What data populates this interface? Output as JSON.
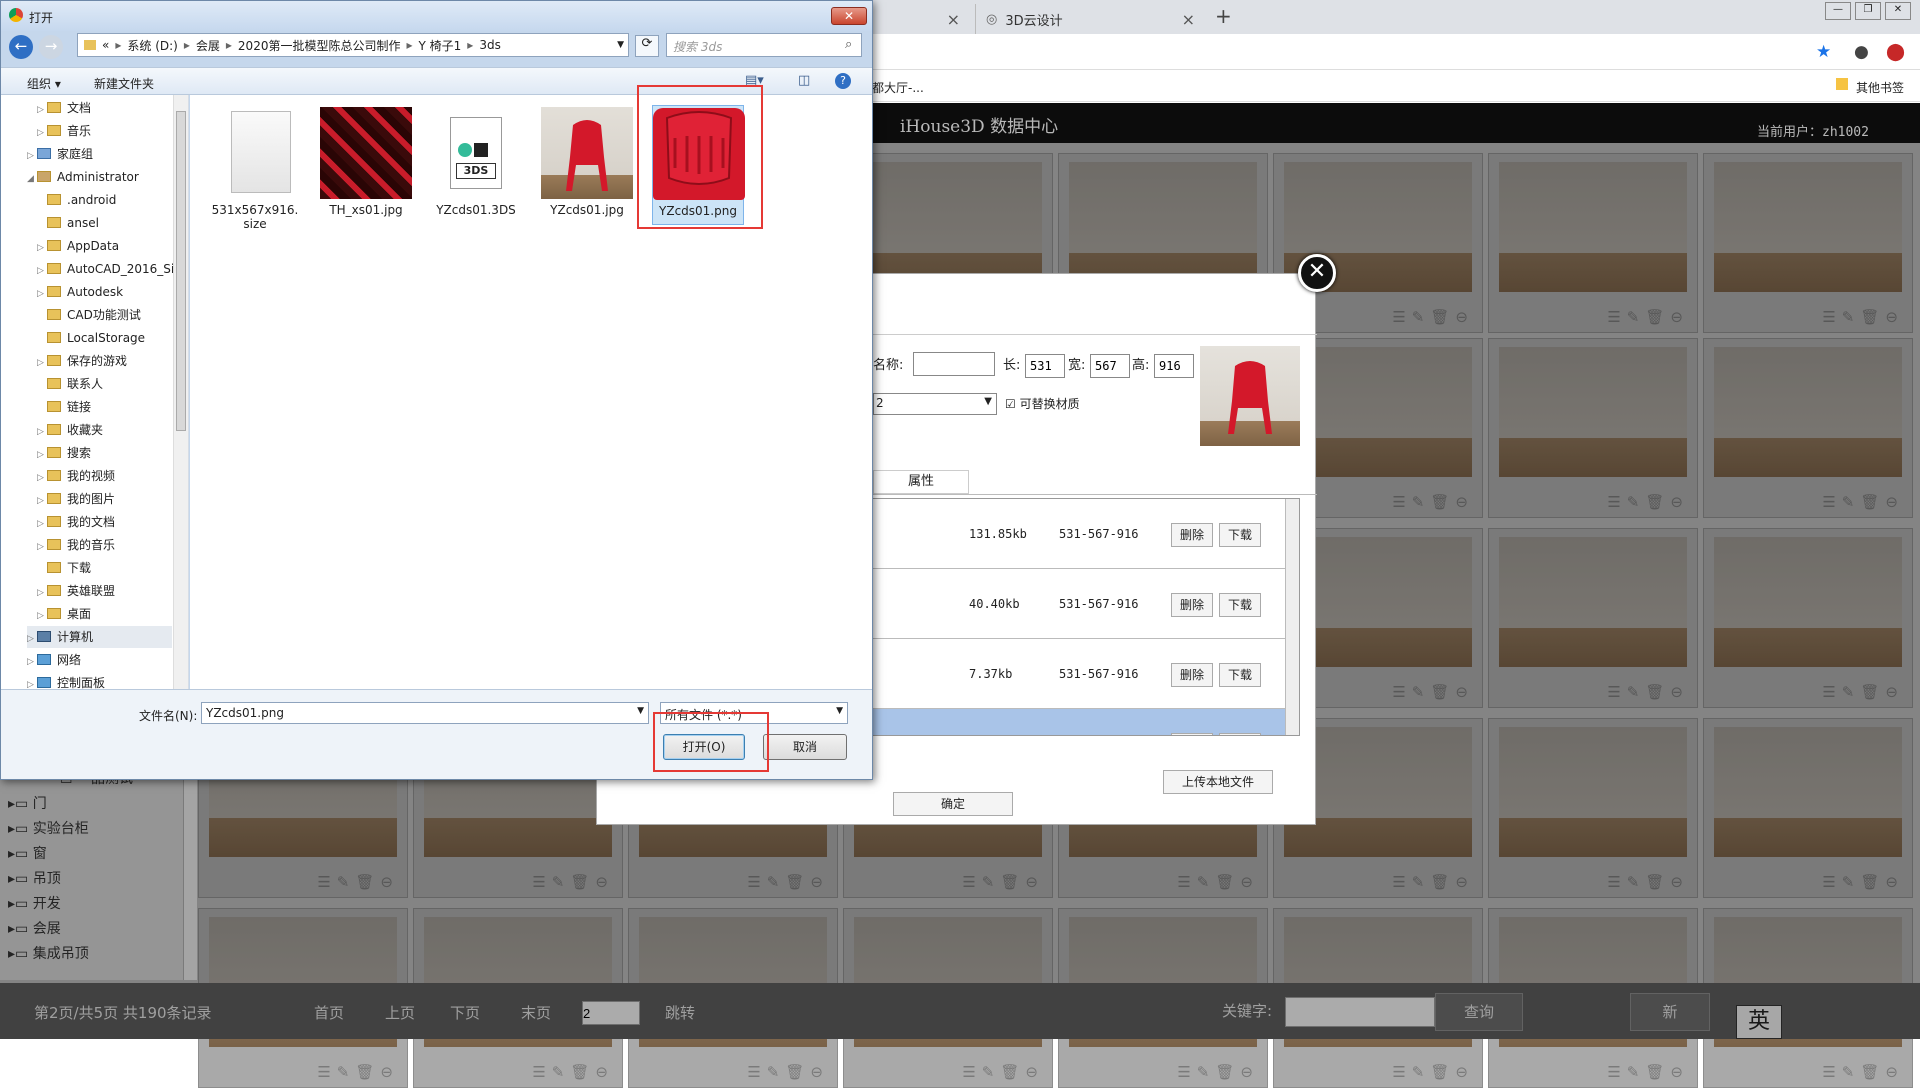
{
  "browser": {
    "tabs": [
      {
        "label": ""
      },
      {
        "label": "3D云设计"
      }
    ],
    "bookmark_partial": "都大厅-...",
    "other_bookmarks": "其他书签"
  },
  "app": {
    "title": "iHouse3D 数据中心",
    "current_user": "当前用户：zh1002"
  },
  "left_nav": {
    "items": [
      "会展",
      "一品测试",
      "门",
      "实验台柜",
      "窗",
      "吊顶",
      "开发",
      "会展",
      "集成吊顶"
    ]
  },
  "footer": {
    "page_info": "第2页/共5页  共190条记录",
    "first": "首页",
    "prev": "上页",
    "next": "下页",
    "last": "末页",
    "page_input": "2",
    "jump": "跳转",
    "keyword_label": "关键字:",
    "query_btn": "查询",
    "new_btn": "新",
    "ime_char": "英"
  },
  "modal": {
    "name_label": "名称:",
    "name_value": "",
    "len_label": "长:",
    "len_value": "531",
    "wid_label": "宽:",
    "wid_value": "567",
    "hei_label": "高:",
    "hei_value": "916",
    "select_value": "2",
    "replace_material": "可替换材质",
    "tab_attr": "属性",
    "rows": [
      {
        "size": "131.85kb",
        "dims": "531-567-916",
        "delete": "删除",
        "download": "下载"
      },
      {
        "size": "40.40kb",
        "dims": "531-567-916",
        "delete": "删除",
        "download": "下载"
      },
      {
        "size": "7.37kb",
        "dims": "531-567-916",
        "delete": "删除",
        "download": "下载"
      },
      {
        "size": "",
        "dims": "",
        "delete": "删除",
        "download": "下载"
      }
    ],
    "upload": "上传本地文件",
    "confirm": "确定"
  },
  "dialog": {
    "title": "打开",
    "path": [
      "«",
      "系统 (D:)",
      "会展",
      "2020第一批模型陈总公司制作",
      "Y 椅子1",
      "3ds"
    ],
    "search_placeholder": "搜索 3ds",
    "organize": "组织 ▾",
    "new_folder": "新建文件夹",
    "tree": [
      "文档",
      "音乐",
      "家庭组",
      "Administrator",
      ".android",
      "ansel",
      "AppData",
      "AutoCAD_2016_Si",
      "Autodesk",
      "CAD功能测试",
      "LocalStorage",
      "保存的游戏",
      "联系人",
      "链接",
      "收藏夹",
      "搜索",
      "我的视频",
      "我的图片",
      "我的文档",
      "我的音乐",
      "下载",
      "英雄联盟",
      "桌面",
      "计算机",
      "网络",
      "控制面板"
    ],
    "files": [
      {
        "name": "531x567x916.size",
        "type": "blank"
      },
      {
        "name": "TH_xs01.jpg",
        "type": "texture"
      },
      {
        "name": "YZcds01.3DS",
        "type": "3ds"
      },
      {
        "name": "YZcds01.jpg",
        "type": "chair"
      },
      {
        "name": "YZcds01.png",
        "type": "chair-top"
      }
    ],
    "filename_label": "文件名(N):",
    "filename_value": "YZcds01.png",
    "filter_value": "所有文件 (*.*)",
    "open_btn": "打开(O)",
    "cancel_btn": "取消",
    "icon_3ds_text": "3DS"
  },
  "colors": {
    "accent_red": "#e53935",
    "chair_red": "#d3182a"
  }
}
